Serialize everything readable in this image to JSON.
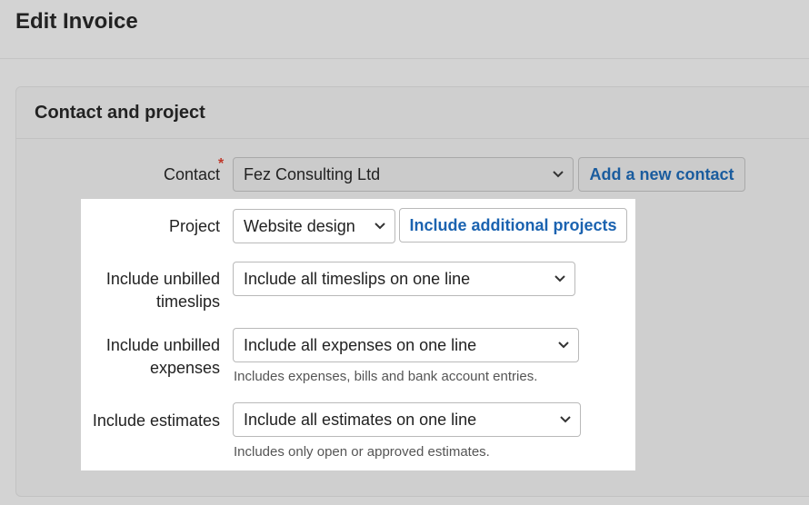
{
  "page": {
    "title": "Edit Invoice"
  },
  "card": {
    "title": "Contact and project"
  },
  "contact": {
    "label": "Contact",
    "required_mark": "*",
    "value": "Fez Consulting Ltd",
    "add_button": "Add a new contact"
  },
  "project": {
    "label": "Project",
    "value": "Website design",
    "include_button": "Include additional projects"
  },
  "timeslips": {
    "label_line1": "Include unbilled",
    "label_line2": "timeslips",
    "value": "Include all timeslips on one line"
  },
  "expenses": {
    "label_line1": "Include unbilled",
    "label_line2": "expenses",
    "value": "Include all expenses on one line",
    "hint": "Includes expenses, bills and bank account entries."
  },
  "estimates": {
    "label": "Include estimates",
    "value": "Include all estimates on one line",
    "hint": "Includes only open or approved estimates."
  },
  "icons": {
    "dropdown": "chevron-down-icon"
  }
}
